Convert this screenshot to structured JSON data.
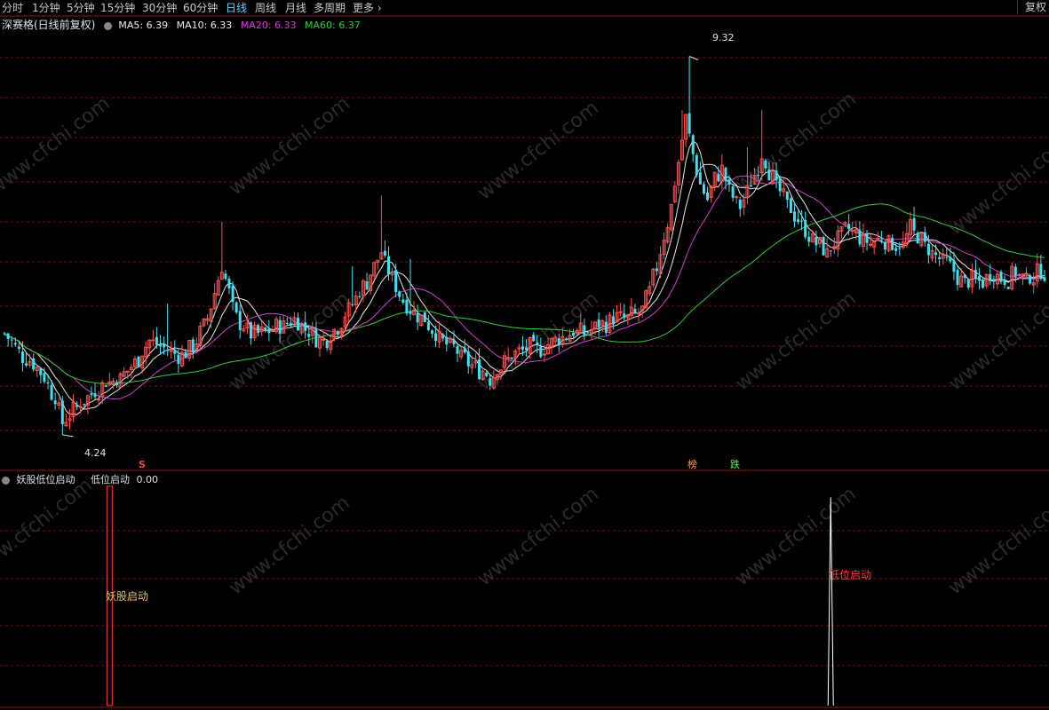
{
  "toolbar": {
    "tabs": [
      {
        "label": "分时"
      },
      {
        "label": "1分钟"
      },
      {
        "label": "5分钟"
      },
      {
        "label": "15分钟"
      },
      {
        "label": "30分钟"
      },
      {
        "label": "60分钟"
      },
      {
        "label": "日线",
        "active": true
      },
      {
        "label": "周线"
      },
      {
        "label": "月线"
      },
      {
        "label": "多周期"
      },
      {
        "label": "更多"
      }
    ],
    "restore_label": "复权"
  },
  "main_panel": {
    "stock_label": "深赛格(日线前复权)",
    "ma": [
      {
        "label": "MA5: 6.39",
        "color": "#e8e8e8"
      },
      {
        "label": "MA10: 6.33",
        "color": "#e8e8e8"
      },
      {
        "label": "MA20: 6.33",
        "color": "#d040d0"
      },
      {
        "label": "MA60: 6.37",
        "color": "#33cc33"
      }
    ],
    "high_label": "9.32",
    "low_label": "4.24",
    "s_marker": "S",
    "mark_bang": "榜",
    "mark_die": "跌"
  },
  "indicator_panel": {
    "title": "妖股低位启动",
    "value_label": "低位启动",
    "value": "0.00",
    "signal1_label": "妖股启动",
    "signal2_label": "低位启动"
  },
  "watermark": "www.cfchi.com",
  "colors": {
    "up": "#ff5050",
    "down": "#40e0f0",
    "ma5": "#e8e8e8",
    "ma10": "#e8e8e8",
    "ma20": "#d040d0",
    "ma60": "#33cc33",
    "grid": "#6e1414",
    "signal1": "#e0c068",
    "signal2": "#ff3b3b"
  },
  "chart_data": {
    "type": "candlestick",
    "ylim": [
      4.0,
      9.6
    ],
    "indicator_ylim": [
      0,
      1
    ],
    "high_value": 9.32,
    "low_value": 4.24,
    "waypoints": [
      [
        0,
        5.6
      ],
      [
        5,
        5.3
      ],
      [
        8,
        5.2
      ],
      [
        11,
        5.0
      ],
      [
        14,
        4.7
      ],
      [
        16,
        4.4
      ],
      [
        18,
        4.5
      ],
      [
        22,
        4.7
      ],
      [
        27,
        4.9
      ],
      [
        32,
        5.0
      ],
      [
        36,
        5.2
      ],
      [
        40,
        5.5
      ],
      [
        44,
        5.4
      ],
      [
        48,
        5.3
      ],
      [
        52,
        5.4
      ],
      [
        56,
        5.8
      ],
      [
        60,
        6.5
      ],
      [
        64,
        5.8
      ],
      [
        68,
        5.6
      ],
      [
        72,
        5.6
      ],
      [
        76,
        5.7
      ],
      [
        80,
        5.8
      ],
      [
        84,
        5.6
      ],
      [
        88,
        5.5
      ],
      [
        92,
        5.7
      ],
      [
        96,
        6.0
      ],
      [
        100,
        6.3
      ],
      [
        104,
        6.7
      ],
      [
        108,
        6.2
      ],
      [
        112,
        5.9
      ],
      [
        116,
        5.8
      ],
      [
        120,
        5.5
      ],
      [
        124,
        5.4
      ],
      [
        128,
        5.2
      ],
      [
        132,
        5.1
      ],
      [
        134,
        5.0
      ],
      [
        136,
        5.1
      ],
      [
        140,
        5.3
      ],
      [
        144,
        5.4
      ],
      [
        148,
        5.4
      ],
      [
        152,
        5.5
      ],
      [
        156,
        5.6
      ],
      [
        160,
        5.6
      ],
      [
        164,
        5.7
      ],
      [
        168,
        5.8
      ],
      [
        172,
        5.8
      ],
      [
        176,
        5.9
      ],
      [
        180,
        6.5
      ],
      [
        184,
        7.3
      ],
      [
        188,
        8.5
      ],
      [
        190,
        8.0
      ],
      [
        192,
        7.6
      ],
      [
        194,
        7.4
      ],
      [
        196,
        7.7
      ],
      [
        198,
        7.8
      ],
      [
        200,
        7.5
      ],
      [
        203,
        7.3
      ],
      [
        206,
        7.6
      ],
      [
        209,
        8.0
      ],
      [
        212,
        7.7
      ],
      [
        215,
        7.4
      ],
      [
        218,
        7.2
      ],
      [
        221,
        7.0
      ],
      [
        224,
        6.8
      ],
      [
        227,
        6.7
      ],
      [
        230,
        6.9
      ],
      [
        233,
        7.0
      ],
      [
        236,
        6.9
      ],
      [
        239,
        6.8
      ],
      [
        242,
        6.9
      ],
      [
        245,
        6.8
      ],
      [
        248,
        6.8
      ],
      [
        250,
        7.0
      ],
      [
        252,
        6.9
      ],
      [
        255,
        6.7
      ],
      [
        258,
        6.6
      ],
      [
        261,
        6.5
      ],
      [
        264,
        6.3
      ],
      [
        267,
        6.3
      ],
      [
        270,
        6.3
      ],
      [
        273,
        6.4
      ],
      [
        276,
        6.3
      ],
      [
        279,
        6.4
      ],
      [
        282,
        6.3
      ],
      [
        285,
        6.4
      ],
      [
        288,
        6.4
      ]
    ],
    "indicator_signals": [
      {
        "x": 29,
        "value": 1,
        "label": "妖股启动"
      },
      {
        "x": 228,
        "value": 0.95,
        "label": "低位启动"
      }
    ]
  }
}
